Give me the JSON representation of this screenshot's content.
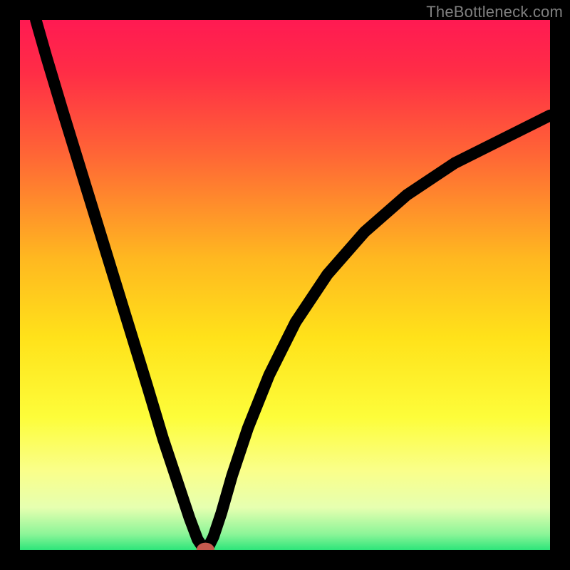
{
  "watermark": "TheBottleneck.com",
  "gradient_stops": [
    {
      "offset": 0.0,
      "color": "#ff1a52"
    },
    {
      "offset": 0.1,
      "color": "#ff2d46"
    },
    {
      "offset": 0.25,
      "color": "#ff6436"
    },
    {
      "offset": 0.45,
      "color": "#ffb820"
    },
    {
      "offset": 0.6,
      "color": "#ffe21a"
    },
    {
      "offset": 0.75,
      "color": "#fdfd3a"
    },
    {
      "offset": 0.85,
      "color": "#faff8a"
    },
    {
      "offset": 0.92,
      "color": "#e6ffb0"
    },
    {
      "offset": 0.97,
      "color": "#8cf598"
    },
    {
      "offset": 1.0,
      "color": "#2de57a"
    }
  ],
  "chart_data": {
    "type": "line",
    "title": "",
    "xlabel": "",
    "ylabel": "",
    "xlim": [
      0,
      100
    ],
    "ylim": [
      0,
      100
    ],
    "grid": false,
    "series": [
      {
        "name": "bottleneck-curve",
        "x": [
          3,
          5,
          8,
          12,
          16,
          20,
          24,
          27,
          30,
          32,
          33.5,
          34.5,
          35,
          35.5,
          36.5,
          38,
          40,
          43,
          47,
          52,
          58,
          65,
          73,
          82,
          92,
          100
        ],
        "y": [
          100,
          93,
          83,
          70,
          57,
          44,
          31,
          21,
          12,
          6,
          2,
          0.5,
          0,
          0.5,
          2.5,
          7,
          14,
          23,
          33,
          43,
          52,
          60,
          67,
          73,
          78,
          82
        ]
      }
    ],
    "marker": {
      "x": 35,
      "y": 0,
      "rx": 1.2,
      "ry": 0.9,
      "color": "#c55a4e"
    }
  }
}
